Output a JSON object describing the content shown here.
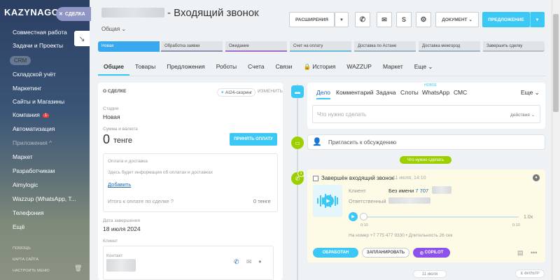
{
  "brand": {
    "logo": "KAZYNAGO",
    "deal_tab": "СДЕЛКА"
  },
  "sidebar": {
    "items": [
      {
        "label": "Совместная работа",
        "badge": ""
      },
      {
        "label": "Задачи и Проекты"
      },
      {
        "label": "CRM"
      },
      {
        "label": "Складской учёт"
      },
      {
        "label": "Маркетинг"
      },
      {
        "label": "Сайты и Магазины"
      },
      {
        "label": "Компания",
        "badge": "1"
      },
      {
        "label": "Автоматизация"
      },
      {
        "label": "Приложения"
      },
      {
        "label": "Маркет"
      },
      {
        "label": "Разработчикам"
      },
      {
        "label": "Aimylogic"
      },
      {
        "label": "Wazzup (WhatsApp, T..."
      },
      {
        "label": "Телефония"
      },
      {
        "label": "Ещё"
      }
    ],
    "footer": [
      "ПОМОЩЬ",
      "КАРТА САЙТА",
      "НАСТРОИТЬ МЕНЮ"
    ]
  },
  "header": {
    "title": "- Входящий звонок",
    "category": "Общая",
    "btn_extensions": "РАСШИРЕНИЯ",
    "btn_document": "ДОКУМЕНТ",
    "btn_offer": "ПРЕДЛОЖЕНИЕ"
  },
  "stages": [
    "Новая",
    "Обработка заявки",
    "Ожидание",
    "Счет на оплату",
    "Доставка по Астане",
    "Доставка межгород",
    "Завершить сделку"
  ],
  "tabs": [
    "Общие",
    "Товары",
    "Предложения",
    "Роботы",
    "Счета",
    "Связи",
    "История",
    "WAZZUP",
    "Маркет",
    "Еще"
  ],
  "deal": {
    "section": "О СДЕЛКЕ",
    "scoring": "AI24-скоринг",
    "edit": "ИЗМЕНИТЬ",
    "stage_label": "Стадия",
    "stage_value": "Новая",
    "sum_label": "Сумма и валюта",
    "sum_value": "0",
    "currency": "тенге",
    "pay_btn": "ПРИНЯТЬ ОПЛАТУ",
    "pay_title": "Оплата и доставка",
    "pay_info": "Здесь будет информация об оплатах и доставках",
    "add_link": "Добавить",
    "total_label": "Итого к оплате по сделке",
    "total_value": "0 тенге",
    "close_label": "Дата завершения",
    "close_value": "18 июля 2024",
    "client_label": "Клиент",
    "contact_label": "Контакт"
  },
  "activity": {
    "tabs": [
      "Дело",
      "Комментарий",
      "Задача",
      "Слоты",
      "WhatsApp",
      "СМС",
      "Еще"
    ],
    "new_tag": "НОВОЕ",
    "todo_placeholder": "Что нужно сделать",
    "actions": "действия",
    "invite": "Пригласить к обсуждению",
    "todo_pill": "Что нужно сделать",
    "call_title": "Завершён входящий звонок",
    "call_time": "11 июля, 14:10",
    "client_label": "Клиент",
    "client_name": "Без имени",
    "client_phone": "7 707 ",
    "responsible_label": "Ответственный",
    "speed": "1.0x",
    "t_start": "0:10",
    "t_end": "0:10",
    "number_line": "На номер +7 775 477 9330 • Длительность 26 сек",
    "btn_processed": "ОБРАБОТАН",
    "btn_schedule": "ЗАПЛАНИРОВАТЬ",
    "btn_copilot": "COPILOT",
    "date_pill": "11 июля",
    "filter": "ФИЛЬТР",
    "notification_count": "1"
  }
}
